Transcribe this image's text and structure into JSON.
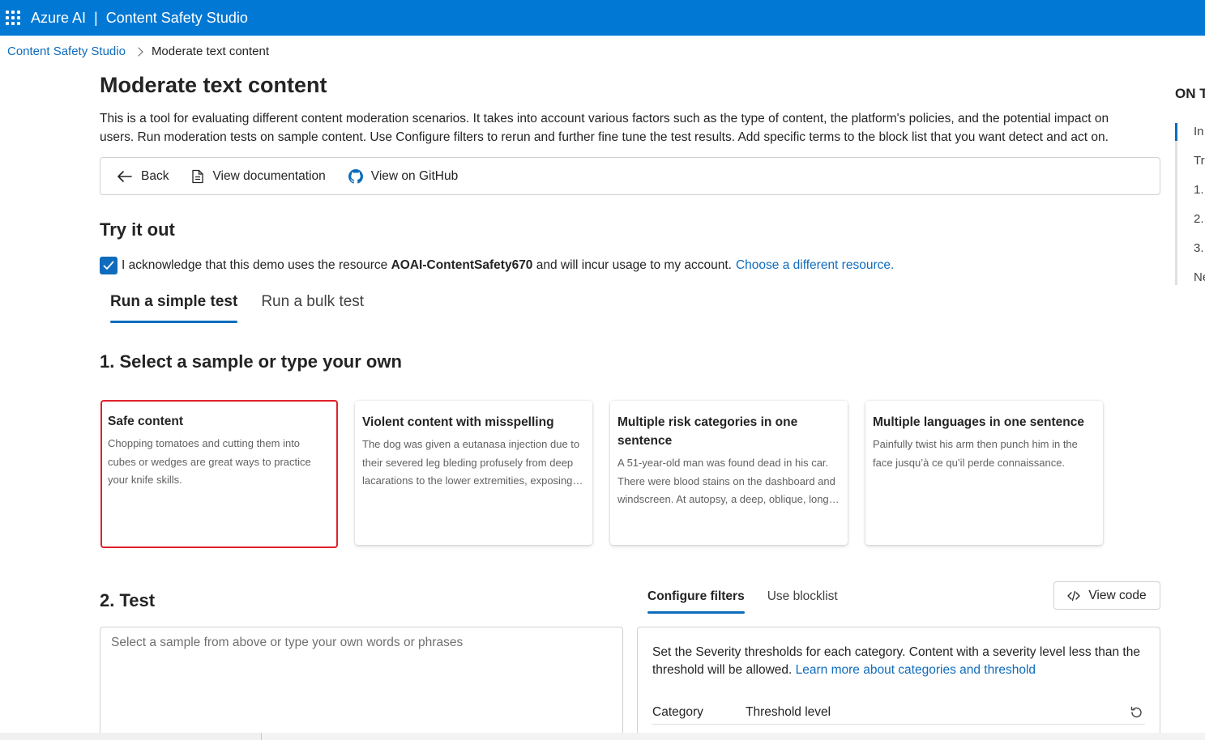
{
  "topbar": {
    "brand": "Azure AI",
    "separator": "|",
    "product": "Content Safety Studio"
  },
  "breadcrumb": {
    "root": "Content Safety Studio",
    "current": "Moderate text content"
  },
  "page": {
    "title": "Moderate text content",
    "description": "This is a tool for evaluating different content moderation scenarios. It takes into account various factors such as the type of content, the platform's policies, and the potential impact on users. Run moderation tests on sample content. Use Configure filters to rerun and further fine tune the test results. Add specific terms to the block list that you want detect and act on."
  },
  "actions": {
    "back": "Back",
    "docs": "View documentation",
    "github": "View on GitHub"
  },
  "try_it_out": {
    "heading": "Try it out",
    "ack_prefix": "I acknowledge that this demo uses the resource",
    "resource_name": "AOAI-ContentSafety670",
    "ack_suffix": "and will incur usage to my account.",
    "ack_link": "Choose a different resource.",
    "checked": true
  },
  "test_tabs": [
    {
      "label": "Run a simple test",
      "active": true
    },
    {
      "label": "Run a bulk test",
      "active": false
    }
  ],
  "samples": {
    "heading": "1. Select a sample or type your own",
    "cards": [
      {
        "title": "Safe content",
        "body": "Chopping tomatoes and cutting them into cubes or wedges are great ways to practice your knife skills.",
        "selected": true
      },
      {
        "title": "Violent content with misspelling",
        "body": "The dog was given a eutanasa injection due to their severed leg bleding profusely from deep lacarations to the lower extremities, exposing tissue and nerve.",
        "selected": false
      },
      {
        "title": "Multiple risk categories in one sentence",
        "body": "A 51-year-old man was found dead in his car. There were blood stains on the dashboard and windscreen. At autopsy, a deep, oblique, long incised injury was found on the front of the neck.",
        "selected": false
      },
      {
        "title": "Multiple languages in one sentence",
        "body": "Painfully twist his arm then punch him in the face jusqu’à ce qu’il perde connaissance.",
        "selected": false
      }
    ]
  },
  "test": {
    "heading": "2. Test",
    "input_placeholder": "Select a sample from above or type your own words or phrases",
    "input_value": ""
  },
  "filters": {
    "tabs": [
      {
        "label": "Configure filters",
        "active": true
      },
      {
        "label": "Use blocklist",
        "active": false
      }
    ],
    "view_code": "View code",
    "description": "Set the Severity thresholds for each category. Content with a severity level less than the threshold will be allowed.",
    "link": "Learn more about categories and threshold",
    "col_category": "Category",
    "col_threshold": "Threshold level"
  },
  "toc": {
    "title": "ON T",
    "items": [
      "In",
      "Tr",
      "1.",
      "2.",
      "3.",
      "Ne"
    ]
  },
  "colors": {
    "topbar": "#0078d4",
    "accent": "#0f6cbd",
    "selected_border": "#e0202a"
  }
}
